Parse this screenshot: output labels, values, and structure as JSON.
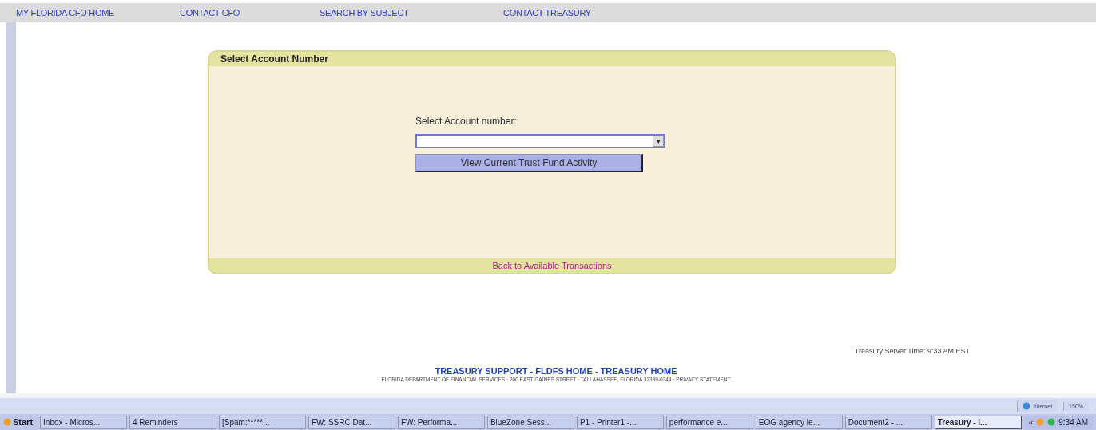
{
  "nav": [
    "MY FLORIDA CFO HOME",
    "CONTACT CFO",
    "SEARCH BY SUBJECT",
    "CONTACT TREASURY"
  ],
  "panel": {
    "title": "Select Account Number",
    "field_label": "Select Account number:",
    "dropdown_arrow": "▾",
    "button": "View Current Trust Fund Activity",
    "back_link": "Back to Available Transactions"
  },
  "server_time": "Treasury Server Time: 9:33 AM EST",
  "footer": {
    "links": [
      "TREASURY SUPPORT",
      "FLDFS HOME",
      "TREASURY HOME"
    ],
    "separator": " - ",
    "address": "FLORIDA DEPARTMENT OF FINANCIAL SERVICES · 200 EAST GAINES STREET · TALLAHASSEE, FLORIDA 32399-0344 · PRIVACY STATEMENT"
  },
  "status_bar": {
    "zone": "Internet",
    "zoom": "150%"
  },
  "taskbar": {
    "start": "Start",
    "items": [
      {
        "label": "Inbox - Micros...",
        "selected": false
      },
      {
        "label": "4 Reminders",
        "selected": false
      },
      {
        "label": "[Spam:*****...",
        "selected": false
      },
      {
        "label": "FW: SSRC Dat...",
        "selected": false
      },
      {
        "label": "FW: Performa...",
        "selected": false
      },
      {
        "label": "BlueZone Sess...",
        "selected": false
      },
      {
        "label": "P1 - Printer1 -...",
        "selected": false
      },
      {
        "label": "performance e...",
        "selected": false
      },
      {
        "label": "EOG agency le...",
        "selected": false
      },
      {
        "label": "Document2 - ...",
        "selected": false
      },
      {
        "label": "Treasury - I...",
        "selected": true
      }
    ],
    "tray_arrow": "«",
    "clock": "9:34 AM"
  }
}
